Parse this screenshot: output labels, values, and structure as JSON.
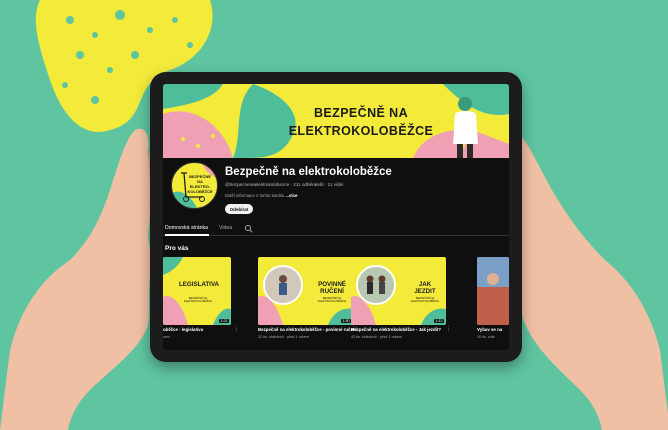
{
  "colors": {
    "background": "#5fc5a0",
    "brand_yellow": "#f3ea3a",
    "brand_pink": "#f0a0b5",
    "brand_teal": "#4dbd9a",
    "screen_bg": "#0f0f0f"
  },
  "banner": {
    "line1": "BEZPEČNĚ NA",
    "line2": "ELEKTROKOLOBĚŽCE"
  },
  "avatar": {
    "line1": "BEZPEČNĚ",
    "line2": "NA",
    "line3": "ELEKTRO-",
    "line4": "KOLOBĚŽCE"
  },
  "channel": {
    "name": "Bezpečně na elektrokoloběžce",
    "meta": "@bezpecnenaelektrokolobezce · 211 odběratelů · 11 videí",
    "description_prefix": "Další informace o tomto kanálu",
    "description_more": "...více",
    "subscribe_label": "Odebírat"
  },
  "tabs": [
    {
      "label": "Domovská stránka",
      "active": true
    },
    {
      "label": "Videa",
      "active": false
    }
  ],
  "section_title": "Pro vás",
  "videos": [
    {
      "thumb_title": "LEGISLATIVA",
      "thumb_sub": "BEZPEČNĚ NA ELEKTROKOLOBĚŽCE",
      "duration": "1:21",
      "title": "oběžce - legislativa",
      "meta": "zení"
    },
    {
      "thumb_title": "POVINNÉ RUČENÍ",
      "thumb_sub": "BEZPEČNĚ NA ELEKTROKOLOBĚŽCE",
      "duration": "1:30",
      "title": "Bezpečně na elektrokoloběžce - povinné ručení",
      "meta": "32 tis. zhlédnutí · před 1 rokem"
    },
    {
      "thumb_title": "JAK JEZDIT",
      "thumb_sub": "BEZPEČNĚ NA ELEKTROKOLOBĚŽCE",
      "duration": "1:12",
      "title": "Bezpečně na elektrokoloběžce - Jak jezdit?",
      "meta": "42 tis. zhlédnutí · před 1 rokem"
    },
    {
      "thumb_title": "",
      "thumb_sub": "",
      "duration": "",
      "title": "Vybav se na",
      "meta": "10 tis. zhlé"
    }
  ]
}
